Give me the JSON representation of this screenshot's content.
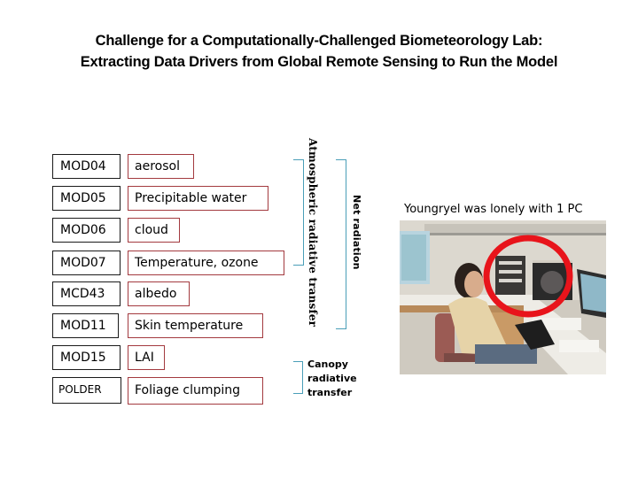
{
  "title": {
    "line1": "Challenge for a Computationally-Challenged Biometeorology Lab:",
    "line2": "Extracting Data Drivers from Global Remote Sensing to Run the Model"
  },
  "rows": [
    {
      "product": "MOD04",
      "variable": "aerosol"
    },
    {
      "product": "MOD05",
      "variable": "Precipitable water"
    },
    {
      "product": "MOD06",
      "variable": "cloud"
    },
    {
      "product": "MOD07",
      "variable": "Temperature, ozone"
    },
    {
      "product": "MCD43",
      "variable": "albedo"
    },
    {
      "product": "MOD11",
      "variable": "Skin temperature"
    },
    {
      "product": "MOD15",
      "variable": "LAI"
    },
    {
      "product": "POLDER",
      "variable": "Foliage clumping"
    }
  ],
  "brackets": {
    "atmospheric": "Atmospheric radiative transfer",
    "net": "Net radiation",
    "canopy_line1": "Canopy",
    "canopy_line2": "radiative",
    "canopy_line3": "transfer"
  },
  "photo": {
    "caption": "Youngryel was lonely with 1 PC",
    "description": "Person seated at a desk with a computer tower circled in red"
  },
  "colors": {
    "product_border": "#1a1a1a",
    "variable_border": "#a33a3f",
    "bracket": "#4a9eb8",
    "highlight_circle": "#e8141b"
  }
}
